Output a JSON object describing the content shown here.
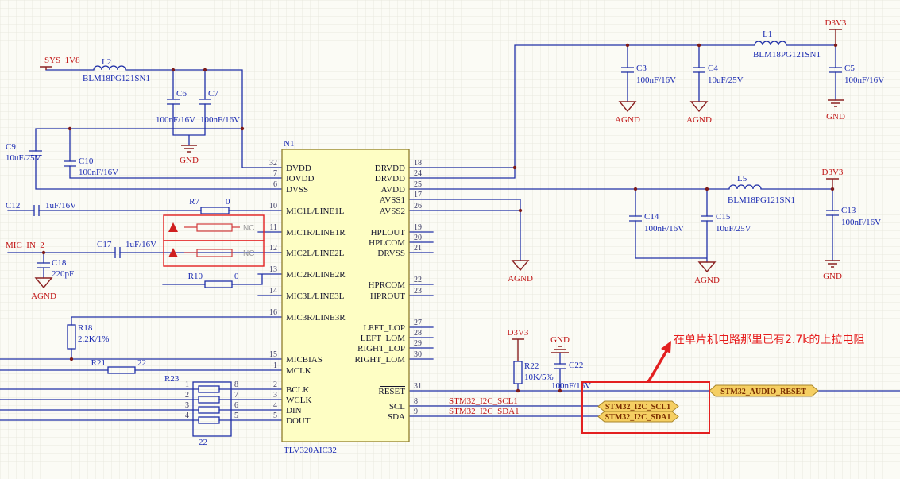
{
  "colors": {
    "wire": "#2030a8",
    "net_label": "#c11616",
    "power_symbol": "#8b2222",
    "designator_text": "#1b2bb2",
    "ic_fill": "#fefec4",
    "ic_border": "#8f7d2a",
    "port_fill": "#f5cf63",
    "port_text": "#7a2e00",
    "highlight_red": "#e32020",
    "nc_gray": "#9b9b9b"
  },
  "ic": {
    "ref": "N1",
    "part": "TLV320AIC32",
    "lp": [
      {
        "num": "32",
        "name": "DVDD"
      },
      {
        "num": "7",
        "name": "IOVDD"
      },
      {
        "num": "6",
        "name": "DVSS"
      },
      {
        "num": "10",
        "name": "MIC1L/LINE1L"
      },
      {
        "num": "11",
        "name": "MIC1R/LINE1R"
      },
      {
        "num": "12",
        "name": "MIC2L/LINE2L"
      },
      {
        "num": "13",
        "name": "MIC2R/LINE2R"
      },
      {
        "num": "14",
        "name": "MIC3L/LINE3L"
      },
      {
        "num": "16",
        "name": "MIC3R/LINE3R"
      },
      {
        "num": "15",
        "name": "MICBIAS"
      },
      {
        "num": "1",
        "name": "MCLK"
      },
      {
        "num": "2",
        "name": "BCLK"
      },
      {
        "num": "3",
        "name": "WCLK"
      },
      {
        "num": "4",
        "name": "DIN"
      },
      {
        "num": "5",
        "name": "DOUT"
      }
    ],
    "rp": [
      {
        "num": "18",
        "name": "DRVDD"
      },
      {
        "num": "24",
        "name": "DRVDD"
      },
      {
        "num": "25",
        "name": "AVDD"
      },
      {
        "num": "17",
        "name": "AVSS1"
      },
      {
        "num": "26",
        "name": "AVSS2"
      },
      {
        "num": "19",
        "name": "HPLOUT"
      },
      {
        "num": "20",
        "name": "HPLCOM"
      },
      {
        "num": "21",
        "name": "DRVSS"
      },
      {
        "num": "22",
        "name": "HPRCOM"
      },
      {
        "num": "23",
        "name": "HPROUT"
      },
      {
        "num": "27",
        "name": "LEFT_LOP"
      },
      {
        "num": "28",
        "name": "LEFT_LOM"
      },
      {
        "num": "29",
        "name": "RIGHT_LOP"
      },
      {
        "num": "30",
        "name": "RIGHT_LOM"
      },
      {
        "num": "31",
        "name": "RESET"
      },
      {
        "num": "8",
        "name": "SCL"
      },
      {
        "num": "9",
        "name": "SDA"
      }
    ]
  },
  "comp": {
    "L1": {
      "r": "L1",
      "v": "BLM18PG121SN1"
    },
    "L2": {
      "r": "L2",
      "v": "BLM18PG121SN1"
    },
    "L5": {
      "r": "L5",
      "v": "BLM18PG121SN1"
    },
    "C3": {
      "r": "C3",
      "v": "100nF/16V"
    },
    "C4": {
      "r": "C4",
      "v": "10uF/25V"
    },
    "C5": {
      "r": "C5",
      "v": "100nF/16V"
    },
    "C6": {
      "r": "C6",
      "v": "100nF/16V"
    },
    "C7": {
      "r": "C7",
      "v": "100nF/16V"
    },
    "C9": {
      "r": "C9",
      "v": "10uF/25V"
    },
    "C10": {
      "r": "C10",
      "v": "100nF/16V"
    },
    "C12": {
      "r": "C12",
      "v": "1uF/16V"
    },
    "C13": {
      "r": "C13",
      "v": "100nF/16V"
    },
    "C14": {
      "r": "C14",
      "v": "100nF/16V"
    },
    "C15": {
      "r": "C15",
      "v": "10uF/25V"
    },
    "C17": {
      "r": "C17",
      "v": "1uF/16V"
    },
    "C18": {
      "r": "C18",
      "v": "220pF"
    },
    "C22": {
      "r": "C22",
      "v": "100nF/16V"
    },
    "R7": {
      "r": "R7",
      "v": "0"
    },
    "R10": {
      "r": "R10",
      "v": "0"
    },
    "R18": {
      "r": "R18",
      "v": "2.2K/1%"
    },
    "R21": {
      "r": "R21",
      "v": "22"
    },
    "R22": {
      "r": "R22",
      "v": "10K/5%"
    },
    "R23": {
      "r": "R23",
      "v": "22"
    }
  },
  "nets": {
    "sys1v8": "SYS_1V8",
    "d3v3": "D3V3",
    "gnd": "GND",
    "agnd": "AGND",
    "mic_in_2": "MIC_IN_2",
    "scl": "STM32_I2C_SCL1",
    "sda": "STM32_I2C_SDA1"
  },
  "ports": {
    "reset": "STM32_AUDIO_RESET",
    "scl": "STM32_I2C_SCL1",
    "sda": "STM32_I2C_SDA1"
  },
  "rn": {
    "left": [
      "1",
      "2",
      "3",
      "4"
    ],
    "right": [
      "8",
      "7",
      "6",
      "5"
    ]
  },
  "nc": "NC",
  "annotation": "在单片机电路那里已有2.7k的上拉电阻"
}
